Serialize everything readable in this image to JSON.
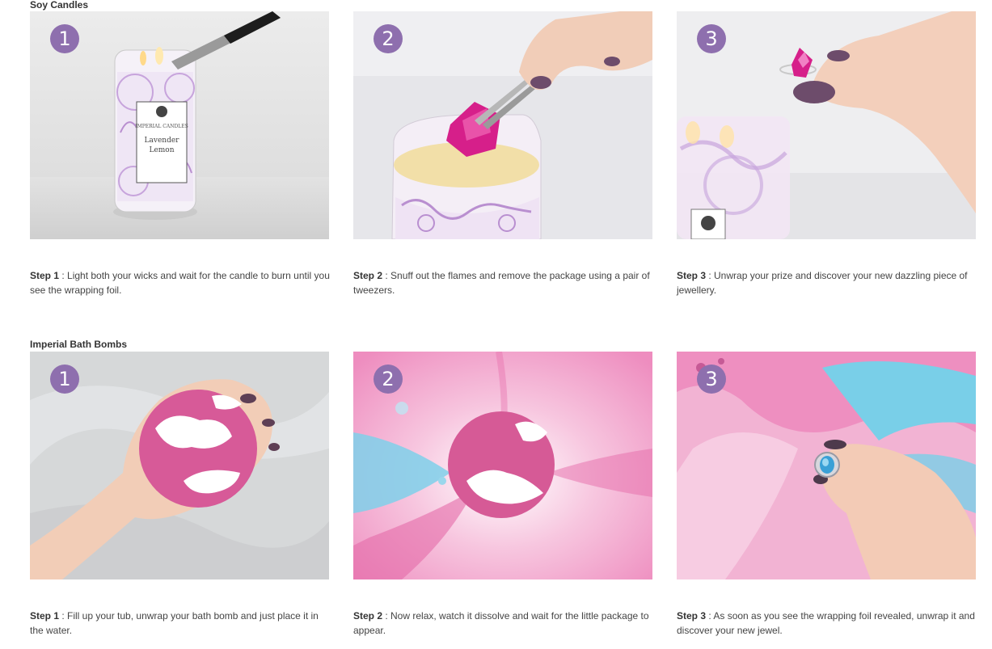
{
  "sections": [
    {
      "title": "Soy Candles",
      "steps": [
        {
          "badge": "1",
          "step_label": "Step 1",
          "text": " : Light both your wicks and wait for the candle to burn until you see the wrapping foil.",
          "jar_label": [
            "IMPERIAL CANDLES",
            "Lavender",
            "Lemon"
          ]
        },
        {
          "badge": "2",
          "step_label": "Step 2",
          "text": " : Snuff out the flames and remove the package using a pair of tweezers."
        },
        {
          "badge": "3",
          "step_label": "Step 3",
          "text": " : Unwrap your prize and discover your new dazzling piece of jewellery."
        }
      ]
    },
    {
      "title": "Imperial Bath Bombs",
      "steps": [
        {
          "badge": "1",
          "step_label": "Step 1",
          "text": " : Fill up your tub, unwrap your bath bomb and just place it in the water."
        },
        {
          "badge": "2",
          "step_label": "Step 2",
          "text": " : Now relax, watch it dissolve and wait for the little package to appear."
        },
        {
          "badge": "3",
          "step_label": "Step 3",
          "text": " : As soon as you see the wrapping foil revealed, unwrap it and discover your new jewel."
        }
      ]
    }
  ],
  "colors": {
    "badge": "#8e6fae",
    "lavender": "#b98fd0",
    "foil": "#d61f8a",
    "bath_pink": "#e86aa8",
    "bath_blue": "#6fc9e6"
  }
}
